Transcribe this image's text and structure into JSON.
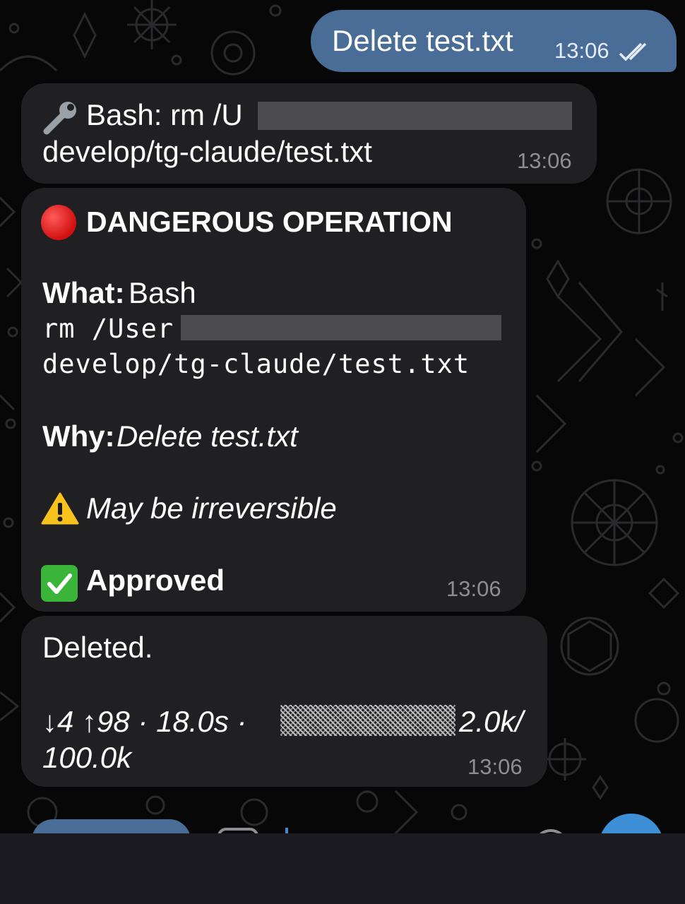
{
  "outgoing": {
    "text": "Delete test.txt",
    "time": "13:06"
  },
  "tool_call": {
    "prefix": "Bash: rm /U",
    "line2": "develop/tg-claude/test.txt",
    "time": "13:06"
  },
  "danger": {
    "title": "DANGEROUS OPERATION",
    "what_label": "What:",
    "what_value": "Bash",
    "cmd_line1": "rm /User",
    "cmd_line2": "develop/tg-claude/test.txt",
    "why_label": "Why:",
    "why_value": "Delete test.txt",
    "warning": "May be irreversible",
    "approved": "Approved",
    "time": "13:06"
  },
  "result": {
    "text": "Deleted.",
    "stats_line1_a": "↓4 ↑98 · 18.0s ·",
    "stats_line1_b": "2.0k/",
    "stats_line2": "100.0k",
    "time": "13:06"
  },
  "colors": {
    "incoming_bubble": "#202022",
    "outgoing_bubble": "#4a6d98",
    "timestamp": "#8d8d93",
    "background": "#070707"
  }
}
